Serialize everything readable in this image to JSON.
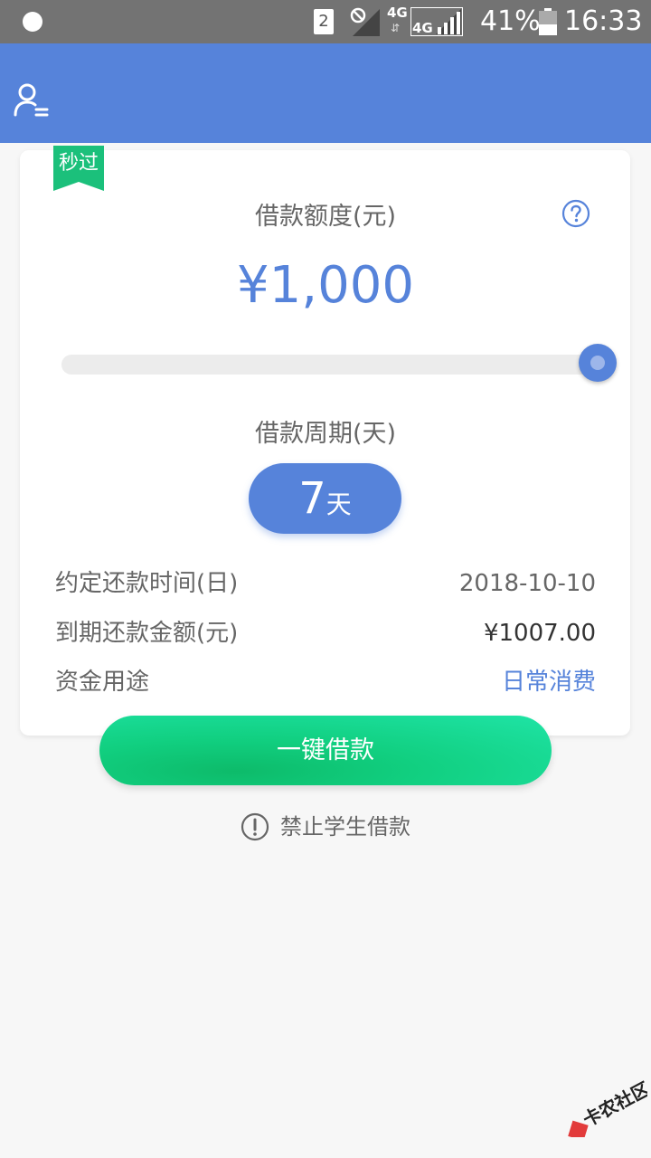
{
  "status_bar": {
    "sim_slot": "2",
    "network_a": "4G",
    "network_b": "4G",
    "battery": "41%",
    "time": "16:33"
  },
  "colors": {
    "primary": "#5683da",
    "accent_green": "#11cf80",
    "ribbon_green": "#1bc07b",
    "text_gray": "#666666"
  },
  "icons": {
    "account": "user-menu-icon",
    "help": "question-circle-icon",
    "notice": "exclamation-circle-icon"
  },
  "card": {
    "ribbon_label": "秒过",
    "amount_label": "借款额度(元)",
    "amount_value": "¥1,000",
    "slider_fraction": 1.0,
    "period_label": "借款周期(天)",
    "period_value": "7",
    "period_unit": "天",
    "rows": [
      {
        "label": "约定还款时间(日)",
        "value": "2018-10-10"
      },
      {
        "label": "到期还款金额(元)",
        "value": "¥1007.00"
      },
      {
        "label": "资金用途",
        "value": "日常消费"
      }
    ]
  },
  "cta_label": "一键借款",
  "notice_text": "禁止学生借款",
  "watermark_text": "卡农社区"
}
